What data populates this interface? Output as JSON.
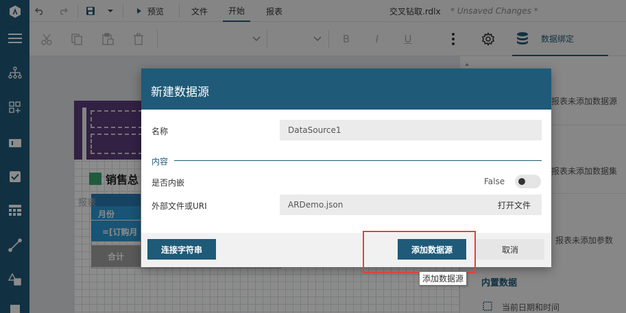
{
  "topbar": {
    "preview_label": "预览",
    "tabs": [
      "文件",
      "开始",
      "报表"
    ],
    "file_name": "交叉钻取.rdlx",
    "unsaved": "* Unsaved Changes *"
  },
  "toolbar": {
    "bold": "B",
    "italic": "I",
    "underline": "U",
    "data_binding_label": "数据绑定"
  },
  "report": {
    "title": "销售总",
    "faded_label": "报表",
    "month_header": "月份",
    "month_expr": "=[订购月",
    "total_label": "合计"
  },
  "right_panel": {
    "no_datasource": "报表未添加数据源",
    "no_dataset": "报表未添加数据集",
    "no_params": "报表未添加参数",
    "builtin_data": "内置数据",
    "current_datetime": "当前日期和时间"
  },
  "dialog": {
    "title": "新建数据源",
    "name_label": "名称",
    "name_value": "DataSource1",
    "section_content": "内容",
    "embedded_label": "是否内嵌",
    "embedded_value": "False",
    "uri_label": "外部文件或URI",
    "uri_value": "ARDemo.json",
    "open_file": "打开文件",
    "conn_string_button": "连接字符串",
    "add_button": "添加数据源",
    "cancel_button": "取消",
    "tooltip": "添加数据源"
  },
  "colors": {
    "primary": "#1f5a78",
    "highlight": "#e0423a"
  }
}
